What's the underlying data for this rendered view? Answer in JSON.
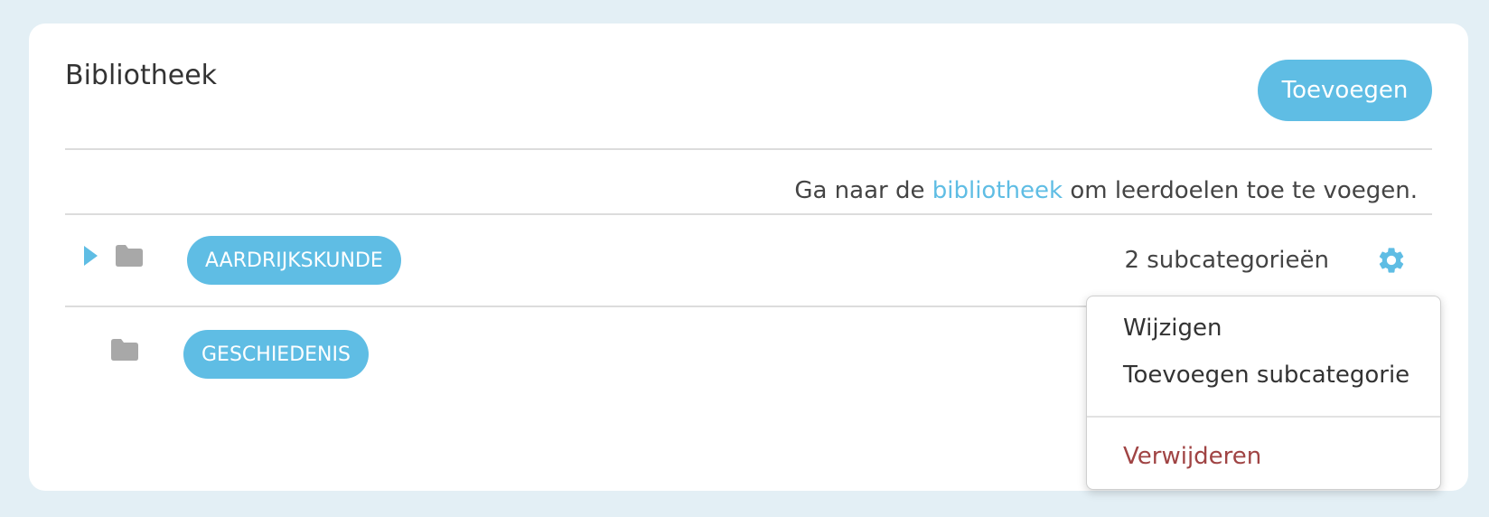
{
  "panel": {
    "title": "Bibliotheek",
    "add_label": "Toevoegen"
  },
  "hint": {
    "before": "Ga naar de ",
    "link": "bibliotheek",
    "after": " om leerdoelen toe te voegen."
  },
  "categories": [
    {
      "label": "AARDRIJKSKUNDE",
      "subcount": "2 subcategorieën",
      "expandable": true
    },
    {
      "label": "GESCHIEDENIS",
      "expandable": false
    }
  ],
  "context_menu": {
    "edit": "Wijzigen",
    "add_subcategory": "Toevoegen subcategorie",
    "delete": "Verwijderen"
  },
  "colors": {
    "background": "#e3eff5",
    "accent": "#5fbde4",
    "danger": "#a04444",
    "folder": "#a8a8a8"
  },
  "icons": {
    "caret": "caret-right-icon",
    "folder": "folder-icon",
    "gear": "gear-icon"
  }
}
